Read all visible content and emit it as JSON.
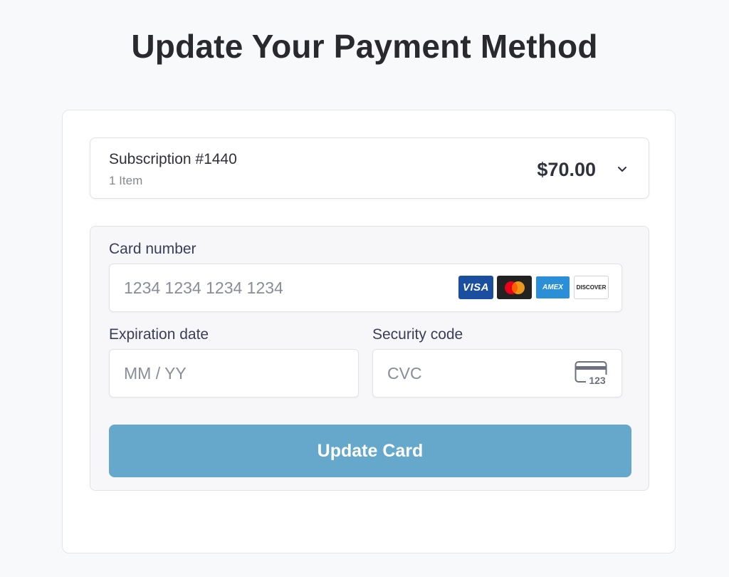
{
  "page": {
    "title": "Update Your Payment Method"
  },
  "summary": {
    "title": "Subscription #1440",
    "items_text": "1 Item",
    "price": "$70.00",
    "toggle_icon": "chevron-down-icon"
  },
  "form": {
    "card_number": {
      "label": "Card number",
      "placeholder": "1234 1234 1234 1234",
      "value": ""
    },
    "brands": [
      {
        "name": "visa",
        "label": "VISA",
        "color": "#1a4fa0"
      },
      {
        "name": "mastercard",
        "label": "",
        "color": "#222222"
      },
      {
        "name": "amex",
        "label": "AMEX",
        "color": "#2a8fd6"
      },
      {
        "name": "discover",
        "label": "DISCOVER",
        "color": "#ffffff"
      }
    ],
    "expiration": {
      "label": "Expiration date",
      "placeholder": "MM / YY",
      "value": ""
    },
    "security_code": {
      "label": "Security code",
      "placeholder": "CVC",
      "value": "",
      "icon": "cvc-card-icon",
      "icon_text": "123"
    },
    "submit_label": "Update Card"
  },
  "colors": {
    "background": "#f8f9fb",
    "button": "#65a8cb",
    "label": "#3a3d57"
  }
}
